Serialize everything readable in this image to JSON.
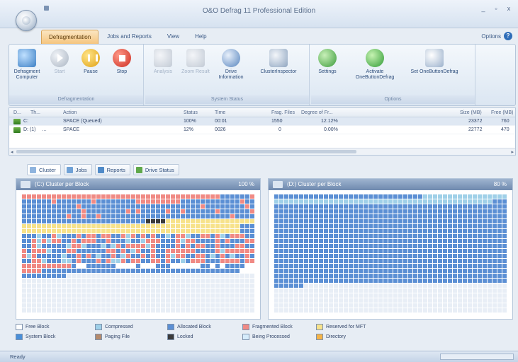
{
  "window": {
    "title": "O&O Defrag 11 Professional Edition",
    "controls": [
      "_",
      "▫",
      "x"
    ]
  },
  "ribbon": {
    "tabs": [
      "Defragmentation",
      "Jobs and Reports",
      "View",
      "Help"
    ],
    "options_label": "Options",
    "groups": [
      {
        "label": "Defragmentation",
        "buttons": [
          {
            "label": "Defragment Computer",
            "icon": "defrag-icon",
            "enabled": true
          },
          {
            "label": "Start",
            "icon": "start-icon",
            "enabled": false
          },
          {
            "label": "Pause",
            "icon": "pause-icon",
            "enabled": true
          },
          {
            "label": "Stop",
            "icon": "stop-icon",
            "enabled": true
          }
        ]
      },
      {
        "label": "System Status",
        "buttons": [
          {
            "label": "Analysis",
            "icon": "analysis-icon",
            "enabled": false
          },
          {
            "label": "Zoom Result",
            "icon": "zoom-icon",
            "enabled": false
          },
          {
            "label": "Drive Information",
            "icon": "drive-info-icon",
            "enabled": true
          },
          {
            "label": "ClusterInspector",
            "icon": "cluster-inspector-icon",
            "enabled": true
          }
        ]
      },
      {
        "label": "Options",
        "buttons": [
          {
            "label": "Settings",
            "icon": "settings-icon",
            "enabled": true
          },
          {
            "label": "Activate OneButtonDefrag",
            "icon": "activate-icon",
            "enabled": true
          },
          {
            "label": "Set OneButtonDefrag",
            "icon": "set-icon",
            "enabled": true
          }
        ]
      }
    ]
  },
  "joblist": {
    "columns": [
      "D...",
      "Th...",
      "Action",
      "Status",
      "Time",
      "Frag. Files",
      "Degree of Fr...",
      "Size (MB)",
      "Free (MB)"
    ],
    "rows": [
      {
        "drive": "C:",
        "th": "",
        "action": "SPACE (Queued)",
        "status": "100%",
        "time": "00:01",
        "frag": "1550",
        "degree": "12.12%",
        "size": "23372",
        "free": "760"
      },
      {
        "drive": "D: (1)",
        "th": "…",
        "action": "SPACE",
        "status": "12%",
        "time": "0026",
        "frag": "0",
        "degree": "0.00%",
        "size": "22772",
        "free": "470"
      }
    ]
  },
  "view_tabs": [
    "Cluster",
    "Jobs",
    "Reports",
    "Drive Status"
  ],
  "maps": [
    {
      "title": "(C:) Cluster per Block",
      "percent": "100 %"
    },
    {
      "title": "(D:) Cluster per Block",
      "percent": "80 %"
    }
  ],
  "legend": [
    {
      "label": "Free Block",
      "color": "#ffffff"
    },
    {
      "label": "Compressed",
      "color": "#9fd0e8"
    },
    {
      "label": "Allocated Block",
      "color": "#5b8fd4"
    },
    {
      "label": "Fragmented Block",
      "color": "#f08a84"
    },
    {
      "label": "Reserved for MFT",
      "color": "#f7e28a"
    },
    {
      "label": "System Block",
      "color": "#4a8fd8"
    },
    {
      "label": "Paging File",
      "color": "#b58a6c"
    },
    {
      "label": "Locked",
      "color": "#3b3b3b"
    },
    {
      "label": "Being Processed",
      "color": "#d6ecfb"
    },
    {
      "label": "Directory",
      "color": "#f5b347"
    }
  ],
  "colors": {
    "allocated": "#5b8fd4",
    "fragmented": "#f08a84",
    "reserved_mft": "#f7e28a",
    "free": "#ffffff",
    "compressed": "#9fd0e8",
    "locked": "#3b3b3b",
    "empty": "#e8eef6"
  },
  "status_bar": {
    "text": "Ready"
  }
}
